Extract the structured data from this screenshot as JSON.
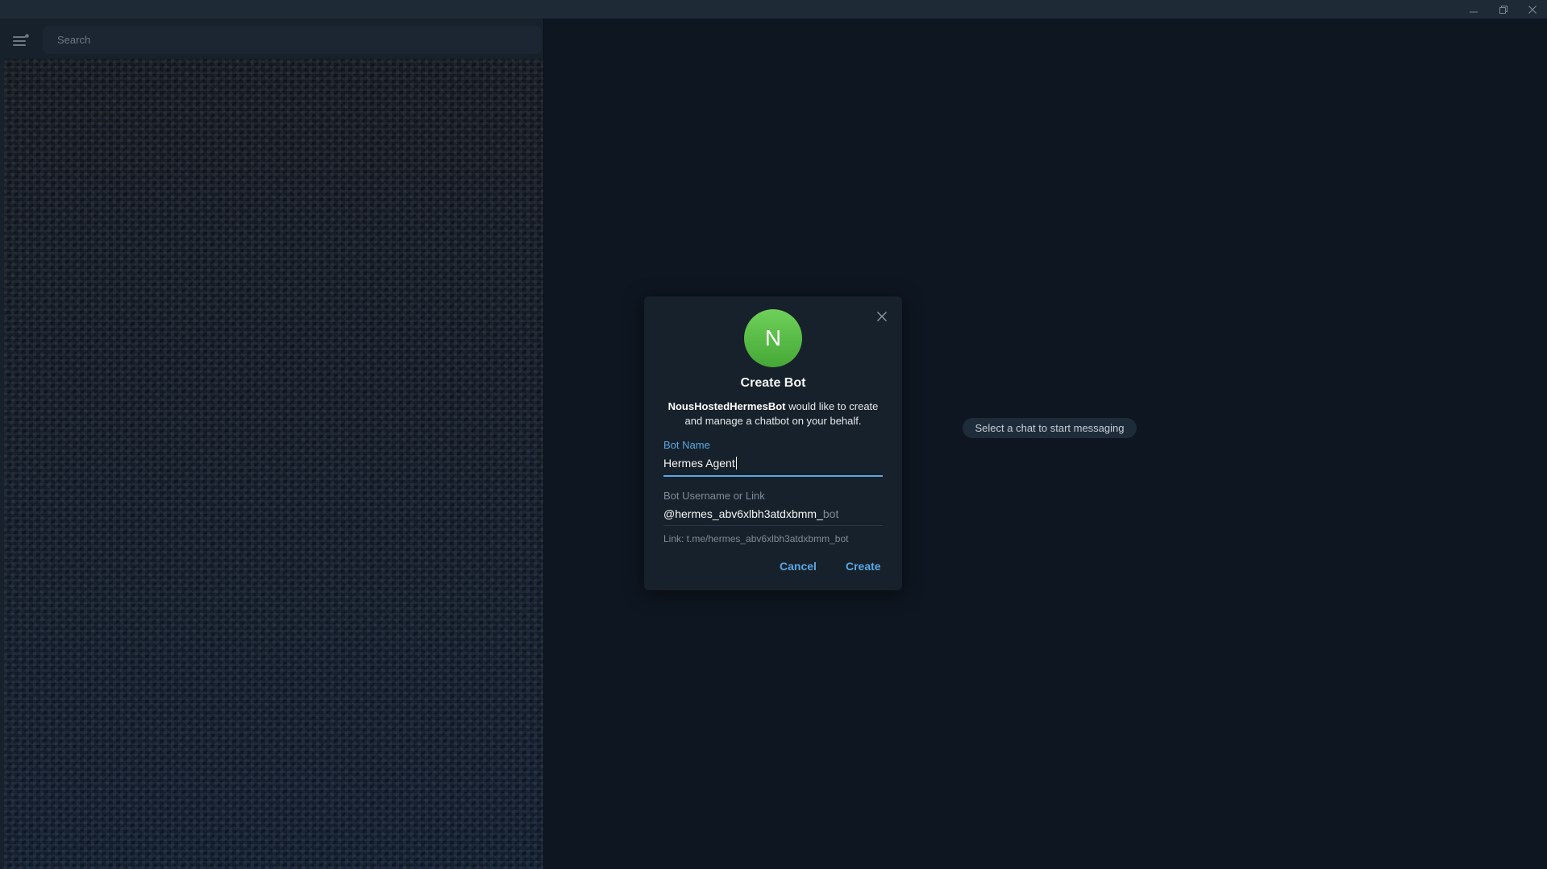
{
  "window": {
    "controls": {
      "minimize_icon": "minimize-icon",
      "maximize_icon": "maximize-icon",
      "close_icon": "close-icon"
    }
  },
  "sidebar": {
    "menu_icon": "hamburger-menu-icon",
    "search": {
      "placeholder": "Search",
      "value": ""
    }
  },
  "main": {
    "empty_state": "Select a chat to start messaging"
  },
  "dialog": {
    "avatar_letter": "N",
    "avatar_color": "#5cc44a",
    "title": "Create Bot",
    "requester": "NousHostedHermesBot",
    "description_rest": " would like to create and manage a chatbot on your behalf.",
    "bot_name_label": "Bot Name",
    "bot_name_value": "Hermes Agent",
    "username_label": "Bot Username or Link",
    "username_value": "@hermes_abv6xlbh3atdxbmm_",
    "username_suffix": "bot",
    "link_text": "Link: t.me/hermes_abv6xlbh3atdxbmm_bot",
    "cancel_label": "Cancel",
    "create_label": "Create"
  },
  "colors": {
    "accent": "#5aa7e4",
    "background": "#0e1621",
    "panel": "#17212b",
    "titlebar": "#1f2a37"
  }
}
